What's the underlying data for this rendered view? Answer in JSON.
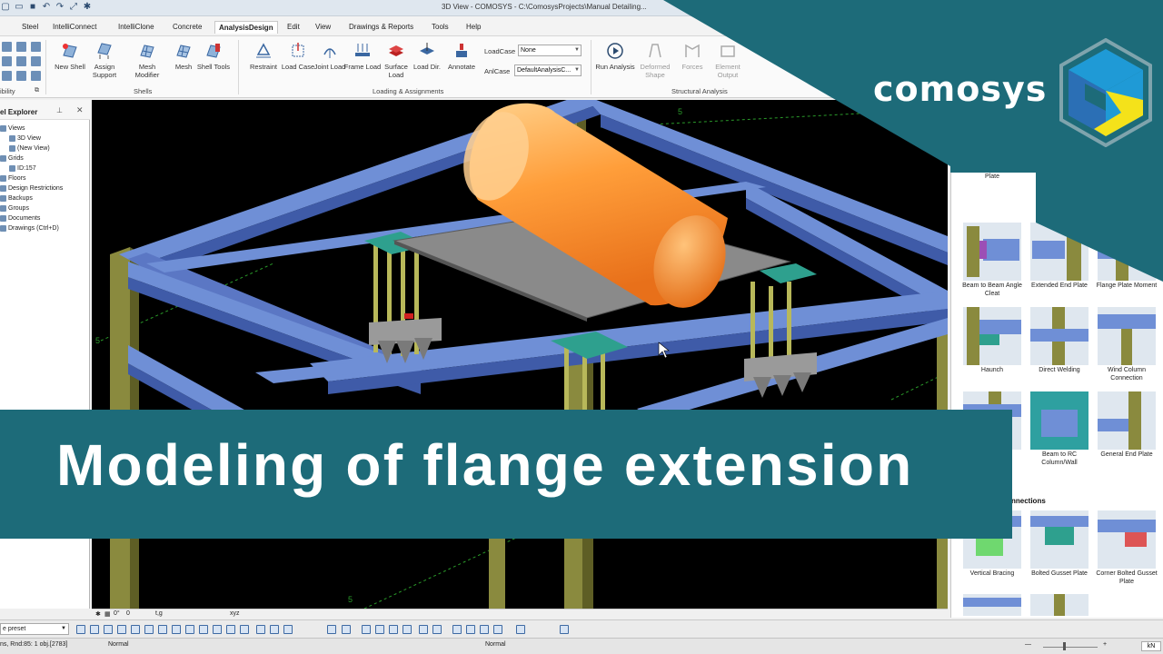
{
  "window": {
    "title": "3D View - COMOSYS - C:\\ComosysProjects\\Manual Detailing..."
  },
  "ribbon_tabs": [
    "Steel",
    "IntelliConnect",
    "IntelliClone",
    "Concrete",
    "AnalysisDesign",
    "Edit",
    "View",
    "Drawings & Reports",
    "Tools",
    "Help"
  ],
  "active_tab": "AnalysisDesign",
  "ribbon": {
    "buttons": {
      "new_shell": "New Shell",
      "assign_support": "Assign Support",
      "mesh_modifier": "Mesh Modifier",
      "mesh": "Mesh",
      "shell_tools": "Shell Tools",
      "restraint": "Restraint",
      "load_case": "Load Case",
      "joint_load": "Joint Load",
      "frame_load": "Frame Load",
      "surface_load": "Surface Load",
      "load_dir": "Load Dir.",
      "annotate": "Annotate",
      "run_analysis": "Run Analysis",
      "deformed_shape": "Deformed Shape",
      "forces": "Forces",
      "element_output": "Element Output"
    },
    "groups": {
      "visibility": "ibility",
      "shells": "Shells",
      "loading": "Loading & Assignments",
      "structural": "Structural Analysis"
    },
    "loadcase_label": "LoadCase",
    "loadcase_value": "None",
    "anlcase_label": "AnlCase",
    "anlcase_value": "DefaultAnalysisC..."
  },
  "explorer": {
    "title": "el Explorer",
    "items": [
      "Views",
      "3D View",
      "(New View)",
      "Grids",
      "ID:157",
      "Floors",
      "Design Restrictions",
      "Backups",
      "Groups",
      "Documents",
      "Drawings (Ctrl+D)"
    ]
  },
  "viewport_labels": {
    "grid_5_top": "5",
    "grid_5_left": "5",
    "grid_5_bottom": "5",
    "toolbar_text_1": "0°",
    "toolbar_text_2": "0",
    "toolbar_text_3": "t,g",
    "toolbar_text_4": "xyz"
  },
  "library": {
    "items": [
      {
        "label": "Beam to Column End Plate"
      },
      {
        "label": "Beam to Beam Angle Cleat"
      },
      {
        "label": "Extended End Plate"
      },
      {
        "label": "Flange Plate Moment"
      },
      {
        "label": "Haunch"
      },
      {
        "label": "Direct Welding"
      },
      {
        "label": "Wind Column Connection"
      },
      {
        "label": ""
      },
      {
        "label": "Beam to RC Column/Wall"
      },
      {
        "label": "General End Plate"
      },
      {
        "label": "Vertical Bracing"
      },
      {
        "label": "Bolted Gusset Plate"
      },
      {
        "label": "Corner Bolted Gusset Plate"
      }
    ],
    "section_heading": "nnections"
  },
  "bottom": {
    "preset": "e preset",
    "status_left": "ns, Rnd:85: 1 obj.[2783]",
    "status_mid1": "Normal",
    "status_mid2": "Normal",
    "unit": "kN"
  },
  "brand": {
    "name": "comosys",
    "teal": "#1d6b79",
    "logo_blue": "#1f9ad6",
    "logo_yellow": "#f4e21a"
  },
  "banner": {
    "headline": "Modeling of flange extension"
  }
}
